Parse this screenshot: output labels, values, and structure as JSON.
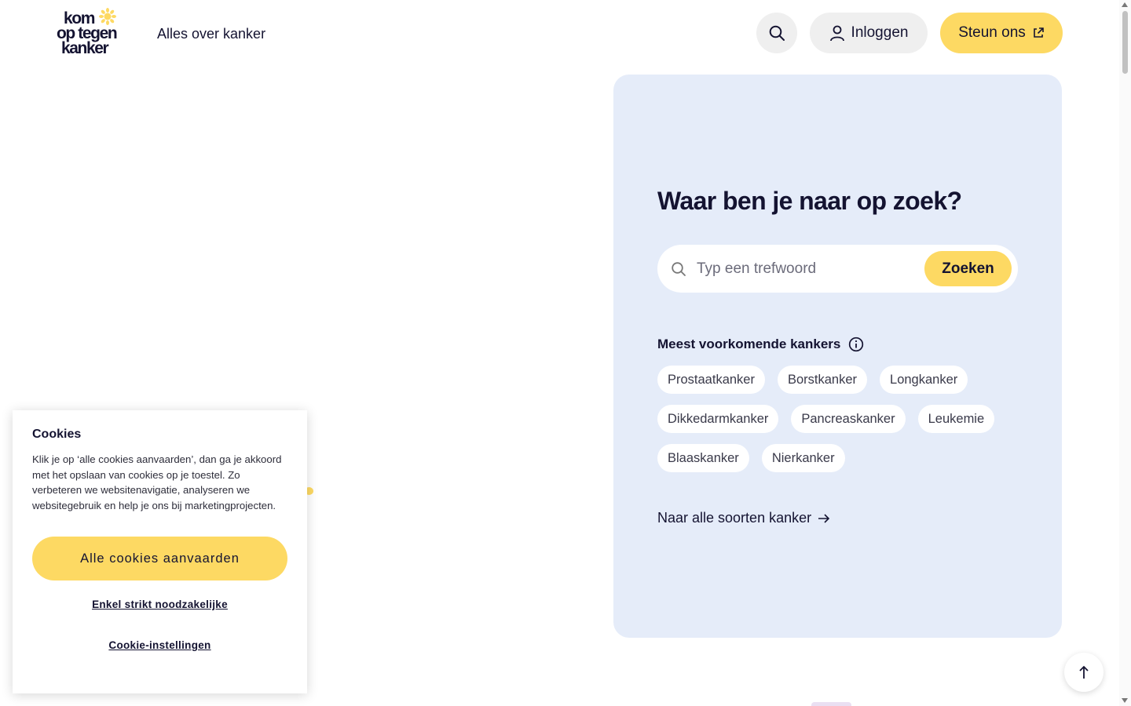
{
  "header": {
    "logo_lines": [
      "kom",
      "op tegen",
      "kanker"
    ],
    "nav_link": "Alles over kanker",
    "search_icon": "search-icon",
    "login_label": "Inloggen",
    "login_icon": "user-icon",
    "support_label": "Steun ons",
    "support_icon": "external-link-icon"
  },
  "search_panel": {
    "heading": "Waar ben je naar op zoek?",
    "input_placeholder": "Typ een trefwoord",
    "input_value": "",
    "search_button": "Zoeken",
    "common_title": "Meest voorkomende kankers",
    "info_icon": "info-icon",
    "chips": [
      "Prostaatkanker",
      "Borstkanker",
      "Longkanker",
      "Dikkedarmkanker",
      "Pancreaskanker",
      "Leukemie",
      "Blaaskanker",
      "Nierkanker"
    ],
    "all_link": "Naar alle soorten kanker"
  },
  "cookie_banner": {
    "title": "Cookies",
    "body": "Klik je op ‘alle cookies aanvaarden’, dan ga je akkoord met het opslaan van cookies op je toestel. Zo verbeteren we websitenavigatie, analyseren we websitegebruik en help je ons bij marketingprojecten.",
    "accept_label": "Alle cookies aanvaarden",
    "strict_label": "Enkel strikt noodzakelijke",
    "settings_label": "Cookie-instellingen"
  },
  "colors": {
    "accent_yellow": "#fdd963",
    "panel_blue": "#e5ecf9",
    "text_dark": "#141331",
    "button_grey": "#efefef"
  }
}
